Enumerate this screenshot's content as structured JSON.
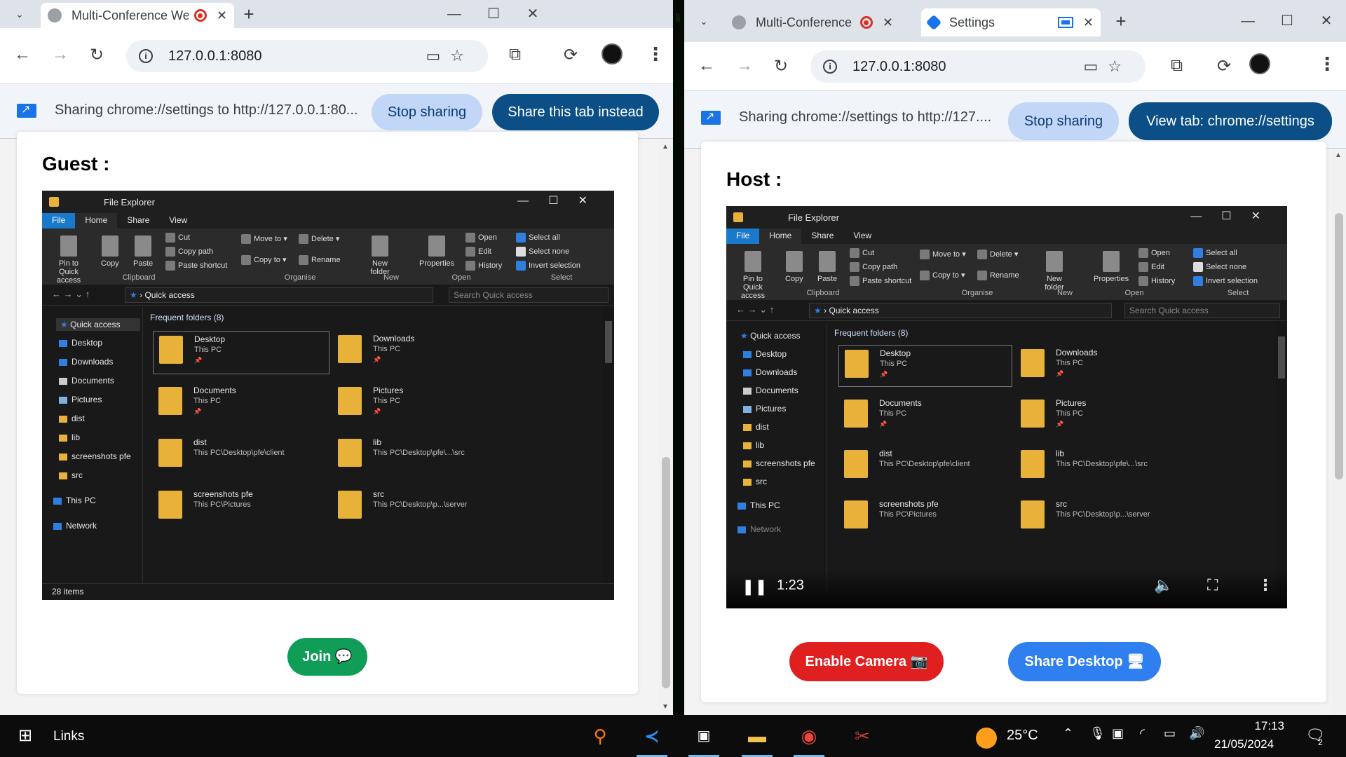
{
  "left_window": {
    "tab_title": "Multi-Conference Website",
    "url": "127.0.0.1:8080",
    "infobar_message": "Sharing chrome://settings to http://127.0.0.1:80...",
    "stop_sharing_label": "Stop sharing",
    "share_this_tab_label": "Share this tab instead",
    "section_title": "Guest :",
    "join_label": "Join 💬"
  },
  "right_window": {
    "tab1_title": "Multi-Conference",
    "tab2_title": "Settings",
    "url": "127.0.0.1:8080",
    "infobar_message": "Sharing chrome://settings to http://127....",
    "stop_sharing_label": "Stop sharing",
    "view_tab_label": "View tab: chrome://settings",
    "section_title": "Host :",
    "video_time": "1:23",
    "enable_camera_label": "Enable Camera 📷",
    "share_desktop_label": "Share Desktop 🖥"
  },
  "file_explorer": {
    "title": "File Explorer",
    "tabs": [
      "File",
      "Home",
      "Share",
      "View"
    ],
    "ribbon": {
      "pin_label": "Pin to Quick access",
      "copy_label": "Copy",
      "paste_label": "Paste",
      "cut_label": "Cut",
      "copy_path_label": "Copy path",
      "paste_shortcut_label": "Paste shortcut",
      "clipboard_group": "Clipboard",
      "move_to_label": "Move to",
      "copy_to_label": "Copy to",
      "delete_label": "Delete",
      "rename_label": "Rename",
      "organise_group": "Organise",
      "new_folder_label": "New folder",
      "new_group": "New",
      "properties_label": "Properties",
      "open_label": "Open",
      "edit_label": "Edit",
      "history_label": "History",
      "open_group": "Open",
      "select_all_label": "Select all",
      "select_none_label": "Select none",
      "invert_selection_label": "Invert selection",
      "select_group": "Select"
    },
    "address": "Quick access",
    "search_placeholder": "Search Quick access",
    "nav": {
      "quick_access": "Quick access",
      "desktop": "Desktop",
      "downloads": "Downloads",
      "documents": "Documents",
      "pictures": "Pictures",
      "dist": "dist",
      "lib": "lib",
      "screenshots": "screenshots pfe",
      "src": "src",
      "this_pc": "This PC",
      "network": "Network"
    },
    "group_header": "Frequent folders (8)",
    "tiles": [
      {
        "name": "Desktop",
        "location": "This PC"
      },
      {
        "name": "Downloads",
        "location": "This PC"
      },
      {
        "name": "Documents",
        "location": "This PC"
      },
      {
        "name": "Pictures",
        "location": "This PC"
      },
      {
        "name": "dist",
        "location": "This PC\\Desktop\\pfe\\client"
      },
      {
        "name": "lib",
        "location": "This PC\\Desktop\\pfe\\...\\src"
      },
      {
        "name": "screenshots pfe",
        "location": "This PC\\Pictures"
      },
      {
        "name": "src",
        "location": "This PC\\Desktop\\p...\\server"
      }
    ],
    "status": "28 items"
  },
  "taskbar": {
    "links_label": "Links",
    "temperature": "25°C",
    "time": "17:13",
    "date": "21/05/2024",
    "notification_count": "2"
  },
  "colors": {
    "join": "#0f9d58",
    "enable_camera": "#e02020",
    "share_desktop": "#2f7ff0",
    "share_button": "#0b4f86",
    "stop_button": "#c2d7f7"
  }
}
